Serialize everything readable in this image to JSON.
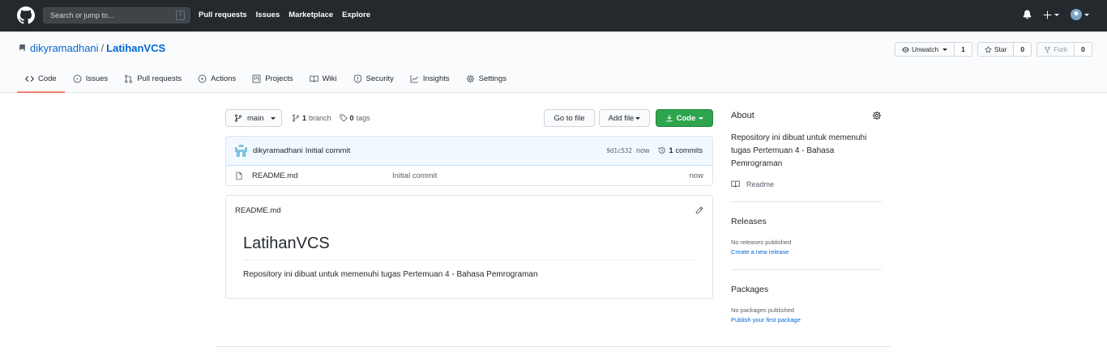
{
  "header": {
    "search_placeholder": "Search or jump to...",
    "search_shortcut": "/",
    "nav": [
      "Pull requests",
      "Issues",
      "Marketplace",
      "Explore"
    ]
  },
  "repo": {
    "owner": "dikyramadhani",
    "separator": "/",
    "name": "LatihanVCS",
    "watch_label": "Unwatch",
    "watch_count": "1",
    "star_label": "Star",
    "star_count": "0",
    "fork_label": "Fork",
    "fork_count": "0"
  },
  "tabs": [
    "Code",
    "Issues",
    "Pull requests",
    "Actions",
    "Projects",
    "Wiki",
    "Security",
    "Insights",
    "Settings"
  ],
  "branch": {
    "current": "main",
    "branch_count": "1",
    "branch_word": "branch",
    "tag_count": "0",
    "tag_word": "tags"
  },
  "buttons": {
    "goto_file": "Go to file",
    "add_file": "Add file",
    "code": "Code"
  },
  "latest_commit": {
    "author": "dikyramadhani",
    "message": "Initial commit",
    "sha": "9d1c532",
    "age": "now",
    "commits_count": "1",
    "commits_word": "commits"
  },
  "files": [
    {
      "name": "README.md",
      "commit": "Initial commit",
      "age": "now"
    }
  ],
  "readme": {
    "filename": "README.md",
    "heading": "LatihanVCS",
    "body": "Repository ini dibuat untuk memenuhi tugas Pertemuan 4 - Bahasa Pemrograman"
  },
  "sidebar": {
    "about_title": "About",
    "about_desc": "Repository ini dibuat untuk memenuhi tugas Pertemuan 4 - Bahasa Pemrograman",
    "readme_label": "Readme",
    "releases_title": "Releases",
    "releases_empty": "No releases published",
    "releases_link": "Create a new release",
    "packages_title": "Packages",
    "packages_empty": "No packages published",
    "packages_link": "Publish your first package"
  },
  "colors": {
    "header_bg": "#24292e",
    "link": "#0366d6",
    "code_button": "#2ea44f",
    "active_tab": "#f9826c",
    "commit_bar": "#f1f8ff"
  }
}
